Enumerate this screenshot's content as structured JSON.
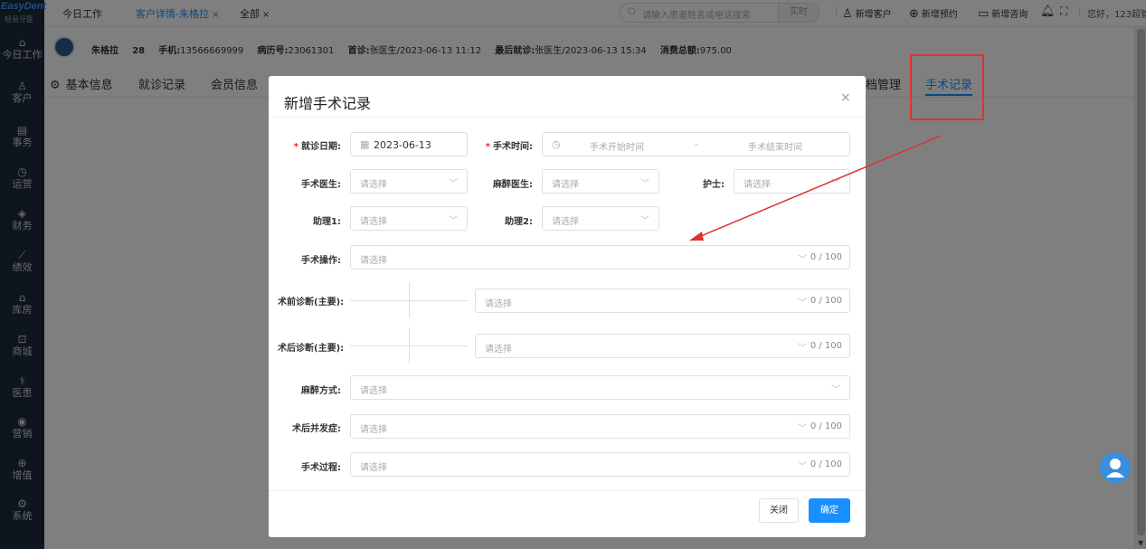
{
  "logo": {
    "brand": "EasyDent",
    "sub": "轻易牙医"
  },
  "sidebar": {
    "items": [
      {
        "icon": "⌂",
        "icon_name": "home-icon",
        "label": "今日工作"
      },
      {
        "icon": "♙",
        "icon_name": "customer-icon",
        "label": "客户"
      },
      {
        "icon": "▤",
        "icon_name": "task-icon",
        "label": "事务"
      },
      {
        "icon": "◷",
        "icon_name": "operation-icon",
        "label": "运营"
      },
      {
        "icon": "◈",
        "icon_name": "finance-icon",
        "label": "财务"
      },
      {
        "icon": "⟋",
        "icon_name": "performance-icon",
        "label": "绩效"
      },
      {
        "icon": "⌂",
        "icon_name": "warehouse-icon",
        "label": "库房"
      },
      {
        "icon": "⊡",
        "icon_name": "mall-icon",
        "label": "商城"
      },
      {
        "icon": "⚕",
        "icon_name": "doctor-icon",
        "label": "医患"
      },
      {
        "icon": "◉",
        "icon_name": "marketing-icon",
        "label": "营销"
      },
      {
        "icon": "⊕",
        "icon_name": "value-added-icon",
        "label": "增值"
      },
      {
        "icon": "⚙",
        "icon_name": "system-icon",
        "label": "系统"
      }
    ]
  },
  "topbar": {
    "tabs": [
      {
        "label": "今日工作",
        "closable": false,
        "active": false
      },
      {
        "label": "客户详情-朱格拉",
        "closable": true,
        "active": true
      },
      {
        "label": "全部",
        "closable": true,
        "active": false
      }
    ],
    "search_placeholder": "请输入患者姓名或电话搜索",
    "search_button": "实时",
    "actions": [
      {
        "icon": "♙",
        "icon_name": "add-customer-icon",
        "label": "新增客户"
      },
      {
        "icon": "⊕",
        "icon_name": "add-appointment-icon",
        "label": "新增预约"
      },
      {
        "icon": "▭",
        "icon_name": "add-consult-icon",
        "label": "新增咨询"
      }
    ],
    "bell": "♫",
    "expand": "⛶",
    "greeting": "您好，123超管"
  },
  "patient": {
    "name": "朱格拉",
    "age": "28",
    "phone_label": "手机:",
    "phone": "13566669999",
    "record_label": "病历号:",
    "record": "23061301",
    "first_label": "首诊:",
    "first": "张医生/2023-06-13 11:12",
    "last_label": "最后就诊:",
    "last": "张医生/2023-06-13 15:34",
    "total_label": "消费总额:",
    "total": "975.00"
  },
  "subtabs": [
    {
      "label": "基本信息",
      "active": false
    },
    {
      "label": "就诊记录",
      "active": false
    },
    {
      "label": "会员信息",
      "active": false
    },
    {
      "label": "档管理",
      "active": false
    },
    {
      "label": "手术记录",
      "active": true
    }
  ],
  "modal": {
    "title": "新增手术记录",
    "close": "×",
    "visit_date_label": "就诊日期:",
    "visit_date_value": "2023-06-13",
    "surgery_time_label": "手术时间:",
    "surgery_start_placeholder": "手术开始时间",
    "surgery_range_sep": "-",
    "surgery_end_placeholder": "手术结束时间",
    "surgeon_label": "手术医生:",
    "anesthetist_label": "麻醉医生:",
    "nurse_label": "护士:",
    "assistant1_label": "助理1:",
    "assistant2_label": "助理2:",
    "operation_label": "手术操作:",
    "pre_diag_label": "术前诊断(主要):",
    "post_diag_label": "术后诊断(主要):",
    "anesthesia_label": "麻醉方式:",
    "complication_label": "术后并发症:",
    "process_label": "手术过程:",
    "select_placeholder": "请选择",
    "counter": "0 / 100",
    "cancel_button": "关闭",
    "ok_button": "确定"
  },
  "colors": {
    "accent": "#1890ff",
    "sidebar_bg": "#1c2b3a",
    "annotation_red": "#e23030",
    "required": "#f5222d"
  }
}
